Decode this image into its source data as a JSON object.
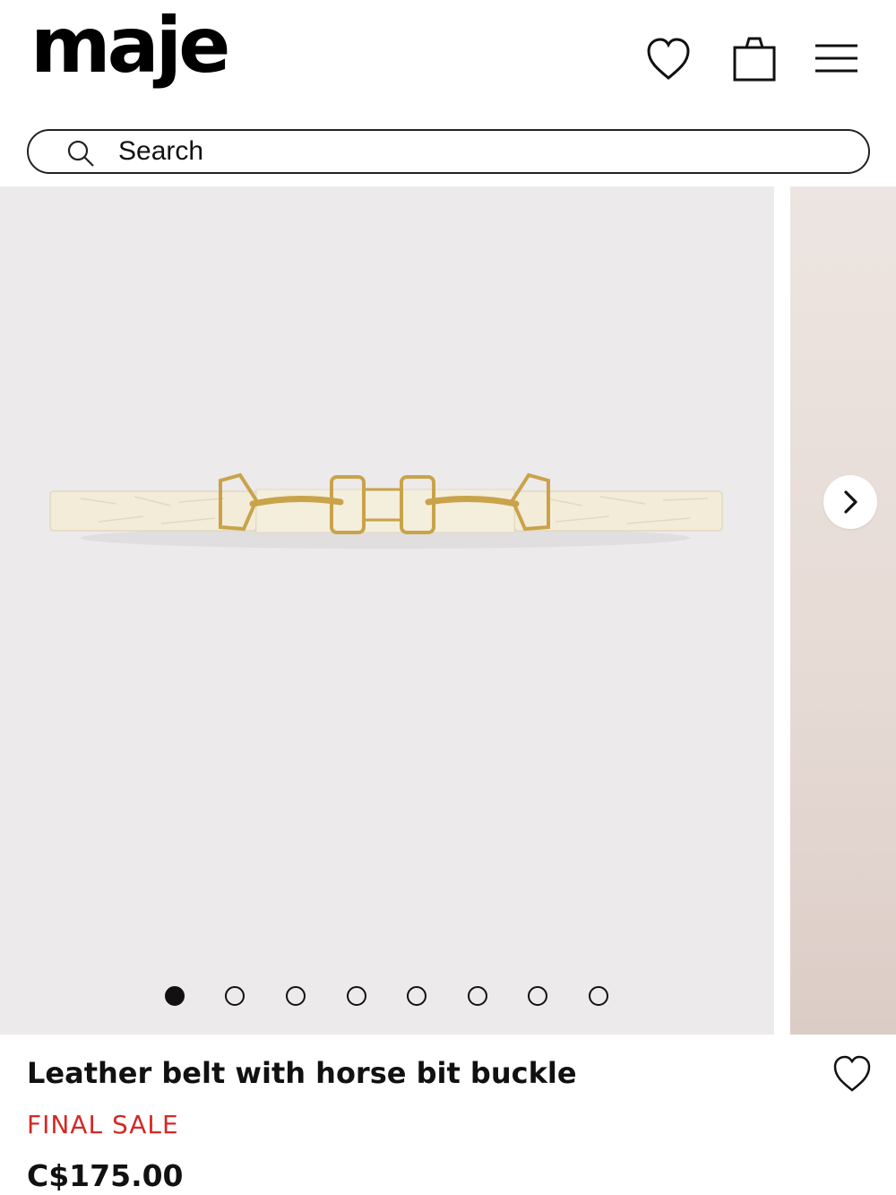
{
  "header": {
    "logo": "maje",
    "icons": [
      "heart-icon",
      "shopping-bag-icon",
      "hamburger-menu-icon"
    ]
  },
  "search": {
    "placeholder": "Search",
    "icon": "search-icon"
  },
  "gallery": {
    "image_count": 8,
    "active_index": 0,
    "next_icon": "chevron-right-icon"
  },
  "product": {
    "title": "Leather belt with horse bit buckle",
    "badge": "FINAL SALE",
    "price": "C$175.00",
    "wishlist_icon": "heart-icon"
  },
  "colors": {
    "sale_red": "#d22a25",
    "image_bg": "#eceaeb",
    "belt_cream": "#f3ecd9",
    "buckle_gold": "#c9a34a"
  }
}
